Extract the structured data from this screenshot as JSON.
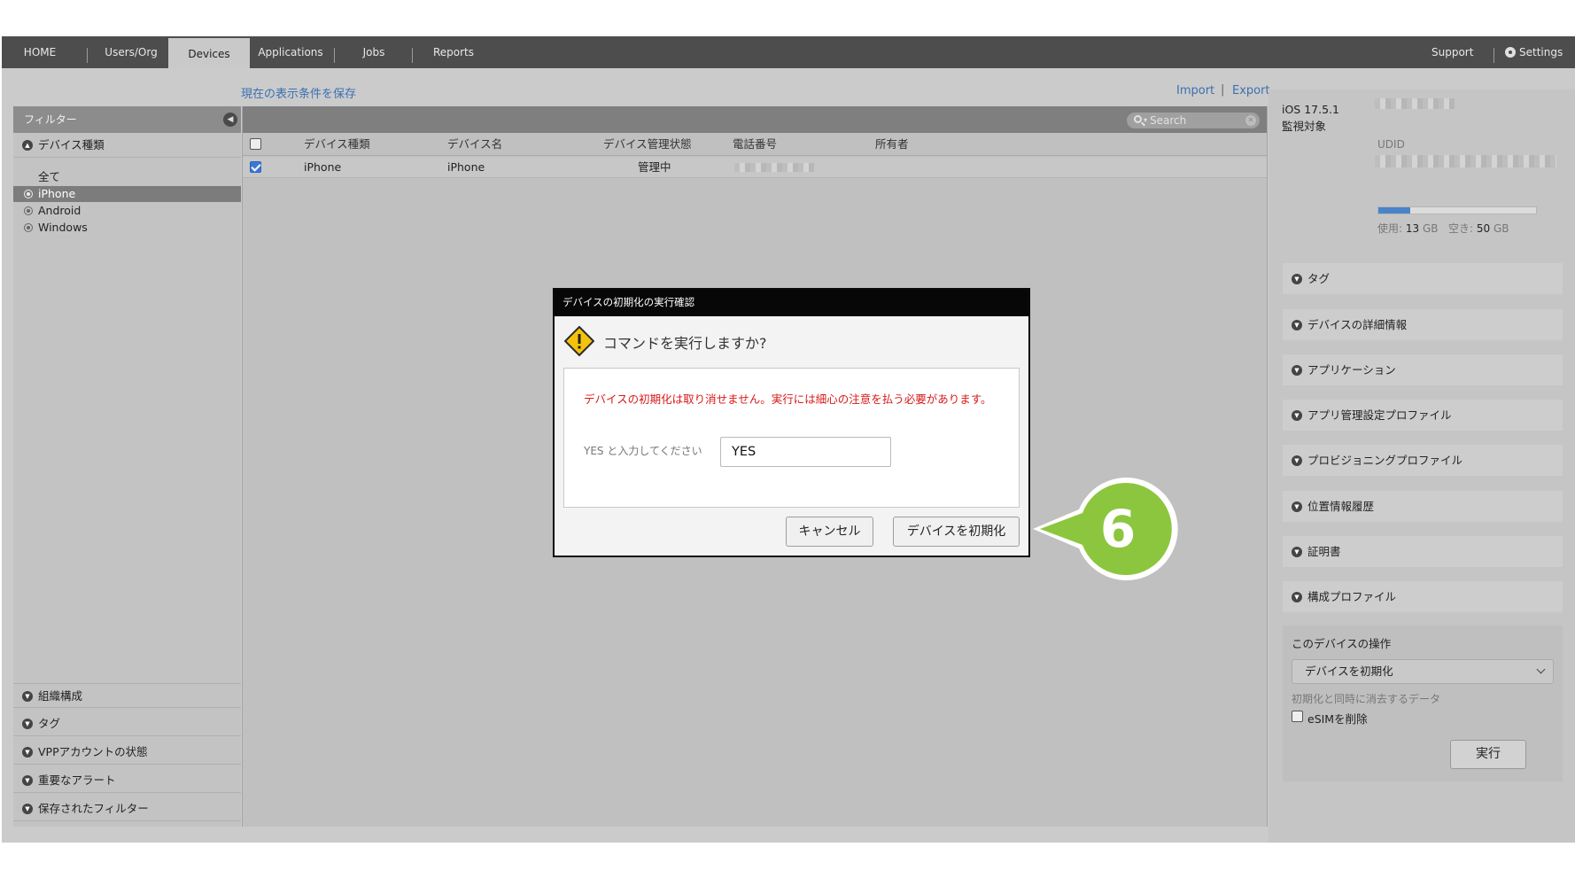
{
  "nav": {
    "tabs": [
      "HOME",
      "Users/Org",
      "Devices",
      "Applications",
      "Jobs",
      "Reports"
    ],
    "support": "Support",
    "settings": "Settings"
  },
  "toolbar": {
    "save_filter": "現在の表示条件を保存",
    "import": "Import",
    "separator": "|",
    "export": "Export"
  },
  "sidebar": {
    "header": "フィルター",
    "device_type": "デバイス種類",
    "filters": [
      "全て",
      "iPhone",
      "Android",
      "Windows"
    ],
    "bottom_sections": [
      "組織構成",
      "タグ",
      "VPPアカウントの状態",
      "重要なアラート",
      "保存されたフィルター"
    ]
  },
  "table": {
    "search_placeholder": "Search",
    "columns": [
      "デバイス種類",
      "デバイス名",
      "デバイス管理状態",
      "電話番号",
      "所有者"
    ],
    "rows": [
      {
        "type": "iPhone",
        "name": "iPhone",
        "status": "管理中",
        "checked": true
      }
    ]
  },
  "detail": {
    "os": "iOS 17.5.1",
    "supervised": "監視対象",
    "udid_label": "UDID",
    "used_label": "使用:",
    "used_value": "13",
    "free_label": "空き:",
    "free_value": "50",
    "unit": "GB",
    "storage_used_fraction": 0.2,
    "sections": [
      "タグ",
      "デバイスの詳細情報",
      "アプリケーション",
      "アプリ管理設定プロファイル",
      "プロビジョニングプロファイル",
      "位置情報履歴",
      "証明書",
      "構成プロファイル"
    ],
    "ops_title": "このデバイスの操作",
    "ops_selected": "デバイスを初期化",
    "erase_data_label": "初期化と同時に消去するデータ",
    "esim_label": "eSIMを削除",
    "execute": "実行"
  },
  "modal": {
    "title": "デバイスの初期化の実行確認",
    "question": "コマンドを実行しますか?",
    "warning": "デバイスの初期化は取り消せません。実行には細心の注意を払う必要があります。",
    "yes_label": "YES と入力してください",
    "yes_value": "YES",
    "cancel": "キャンセル",
    "confirm": "デバイスを初期化"
  },
  "callout": {
    "number": "6"
  },
  "colors": {
    "accent": "#3a70b0",
    "warning_red": "#d81818",
    "callout_green": "#8cc63e"
  }
}
